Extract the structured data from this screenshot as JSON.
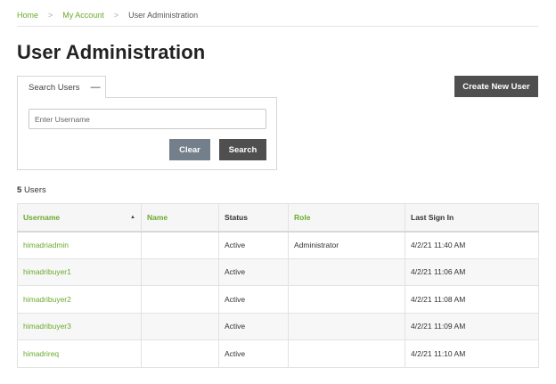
{
  "breadcrumb": {
    "items": [
      "Home",
      "My Account",
      "User Administration"
    ],
    "separator": ">"
  },
  "page": {
    "title": "User Administration"
  },
  "search_tab": {
    "label": "Search Users",
    "collapse_symbol": "—"
  },
  "search": {
    "placeholder": "Enter Username",
    "value": "",
    "clear_label": "Clear",
    "search_label": "Search"
  },
  "create_button": {
    "label": "Create New User"
  },
  "summary": {
    "count": "5",
    "suffix": "Users"
  },
  "table": {
    "columns": [
      "Username",
      "Name",
      "Status",
      "Role",
      "Last Sign In"
    ],
    "sort_indicator": "▲",
    "rows": [
      [
        "himadriadmin",
        "",
        "Active",
        "Administrator",
        "4/2/21 11:40 AM"
      ],
      [
        "himadribuyer1",
        "",
        "Active",
        "",
        "4/2/21 11:06 AM"
      ],
      [
        "himadribuyer2",
        "",
        "Active",
        "",
        "4/2/21 11:08 AM"
      ],
      [
        "himadribuyer3",
        "",
        "Active",
        "",
        "4/2/21 11:09 AM"
      ],
      [
        "himadrireq",
        "",
        "Active",
        "",
        "4/2/21 11:10 AM"
      ]
    ]
  },
  "colors": {
    "accent_green": "#6aaa2c",
    "button_dark": "#4f4f4f",
    "button_slate": "#737f8b"
  }
}
